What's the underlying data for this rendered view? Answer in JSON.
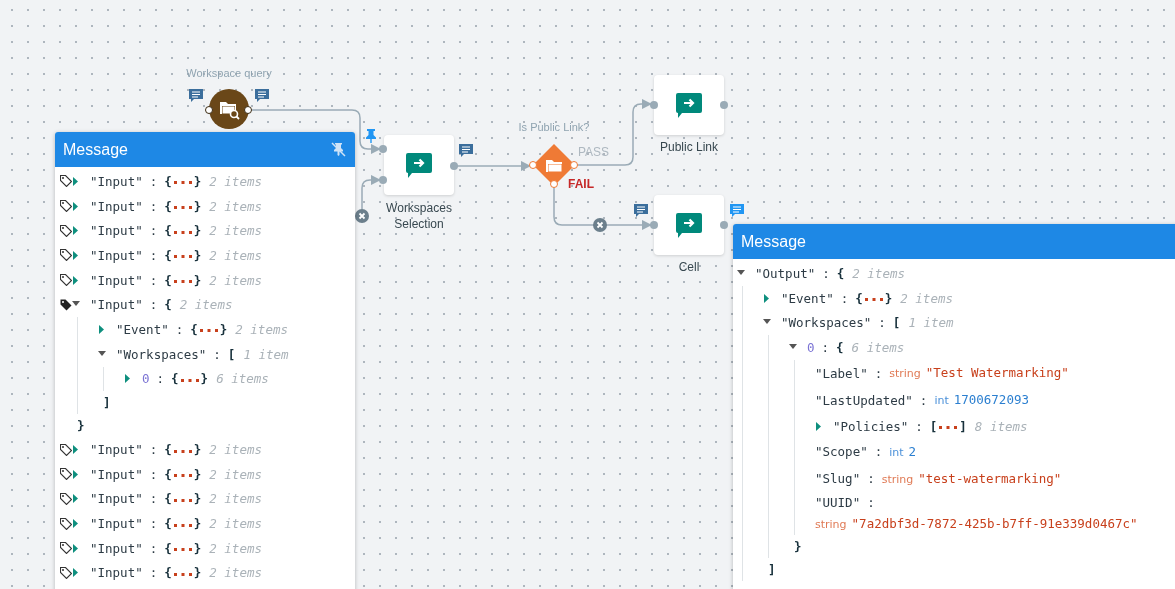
{
  "nodes": [
    {
      "kind": "query",
      "label": "Workspace query"
    },
    {
      "kind": "action",
      "label": "Workspaces Selection"
    },
    {
      "kind": "decision",
      "label": "Is Public Link?",
      "pass": "PASS",
      "fail": "FAIL"
    },
    {
      "kind": "action",
      "label": "Public Link"
    },
    {
      "kind": "action",
      "label": "Cell"
    }
  ],
  "panels": [
    {
      "title": "Message",
      "rows": [
        {
          "kind": "branch",
          "key": "\"Input\"",
          "sep": ":",
          "open": "{",
          "close": "}",
          "count": "2 items",
          "expanded": false,
          "selected": false
        },
        {
          "kind": "branch",
          "key": "\"Input\"",
          "sep": ":",
          "open": "{",
          "close": "}",
          "count": "2 items",
          "expanded": false,
          "selected": false
        },
        {
          "kind": "branch",
          "key": "\"Input\"",
          "sep": ":",
          "open": "{",
          "close": "}",
          "count": "2 items",
          "expanded": false,
          "selected": false
        },
        {
          "kind": "branch",
          "key": "\"Input\"",
          "sep": ":",
          "open": "{",
          "close": "}",
          "count": "2 items",
          "expanded": false,
          "selected": false
        },
        {
          "kind": "branch",
          "key": "\"Input\"",
          "sep": ":",
          "open": "{",
          "close": "}",
          "count": "2 items",
          "expanded": false,
          "selected": false
        },
        {
          "kind": "branch",
          "key": "\"Input\"",
          "sep": ":",
          "open": "{",
          "close": "}",
          "count": "2 items",
          "expanded": true,
          "selected": true,
          "children": [
            {
              "kind": "branch",
              "key": "\"Event\"",
              "sep": ":",
              "open": "{",
              "close": "}",
              "count": "2 items",
              "expanded": false
            },
            {
              "kind": "branch",
              "key": "\"Workspaces\"",
              "sep": ":",
              "open": "[",
              "close": "]",
              "count": "1 item",
              "expanded": true,
              "children": [
                {
                  "kind": "index",
                  "key": "0",
                  "sep": ":",
                  "open": "{",
                  "close": "}",
                  "count": "6 items",
                  "expanded": false
                }
              ]
            }
          ]
        },
        {
          "kind": "branch",
          "key": "\"Input\"",
          "sep": ":",
          "open": "{",
          "close": "}",
          "count": "2 items",
          "expanded": false,
          "selected": false
        },
        {
          "kind": "branch",
          "key": "\"Input\"",
          "sep": ":",
          "open": "{",
          "close": "}",
          "count": "2 items",
          "expanded": false,
          "selected": false
        },
        {
          "kind": "branch",
          "key": "\"Input\"",
          "sep": ":",
          "open": "{",
          "close": "}",
          "count": "2 items",
          "expanded": false,
          "selected": false
        },
        {
          "kind": "branch",
          "key": "\"Input\"",
          "sep": ":",
          "open": "{",
          "close": "}",
          "count": "2 items",
          "expanded": false,
          "selected": false
        },
        {
          "kind": "branch",
          "key": "\"Input\"",
          "sep": ":",
          "open": "{",
          "close": "}",
          "count": "2 items",
          "expanded": false,
          "selected": false
        },
        {
          "kind": "branch",
          "key": "\"Input\"",
          "sep": ":",
          "open": "{",
          "close": "}",
          "count": "2 items",
          "expanded": false,
          "selected": false
        }
      ]
    },
    {
      "title": "Message",
      "rows": [
        {
          "kind": "branch",
          "key": "\"Output\"",
          "sep": ":",
          "open": "{",
          "count": "2 items",
          "expanded": true,
          "children": [
            {
              "kind": "branch",
              "key": "\"Event\"",
              "sep": ":",
              "open": "{",
              "close": "}",
              "count": "2 items",
              "expanded": false
            },
            {
              "kind": "branch",
              "key": "\"Workspaces\"",
              "sep": ":",
              "open": "[",
              "close": "]",
              "count": "1 item",
              "expanded": true,
              "children": [
                {
                  "kind": "index",
                  "key": "0",
                  "sep": ":",
                  "open": "{",
                  "close": "}",
                  "count": "6 items",
                  "expanded": true,
                  "children": [
                    {
                      "kind": "string",
                      "key": "\"Label\"",
                      "sep": ":",
                      "type": "string",
                      "value": "\"Test Watermarking\""
                    },
                    {
                      "kind": "int",
                      "key": "\"LastUpdated\"",
                      "sep": ":",
                      "type": "int",
                      "value": "1700672093"
                    },
                    {
                      "kind": "branch",
                      "key": "\"Policies\"",
                      "sep": ":",
                      "open": "[",
                      "close": "]",
                      "count": "8 items",
                      "expanded": false
                    },
                    {
                      "kind": "int",
                      "key": "\"Scope\"",
                      "sep": ":",
                      "type": "int",
                      "value": "2"
                    },
                    {
                      "kind": "string",
                      "key": "\"Slug\"",
                      "sep": ":",
                      "type": "string",
                      "value": "\"test-watermarking\""
                    },
                    {
                      "kind": "string",
                      "key": "\"UUID\"",
                      "sep": ":",
                      "type": "string",
                      "value": "\"7a2dbf3d-7872-425b-b7ff-91e339d0467c\""
                    }
                  ]
                }
              ]
            }
          ]
        }
      ]
    }
  ]
}
